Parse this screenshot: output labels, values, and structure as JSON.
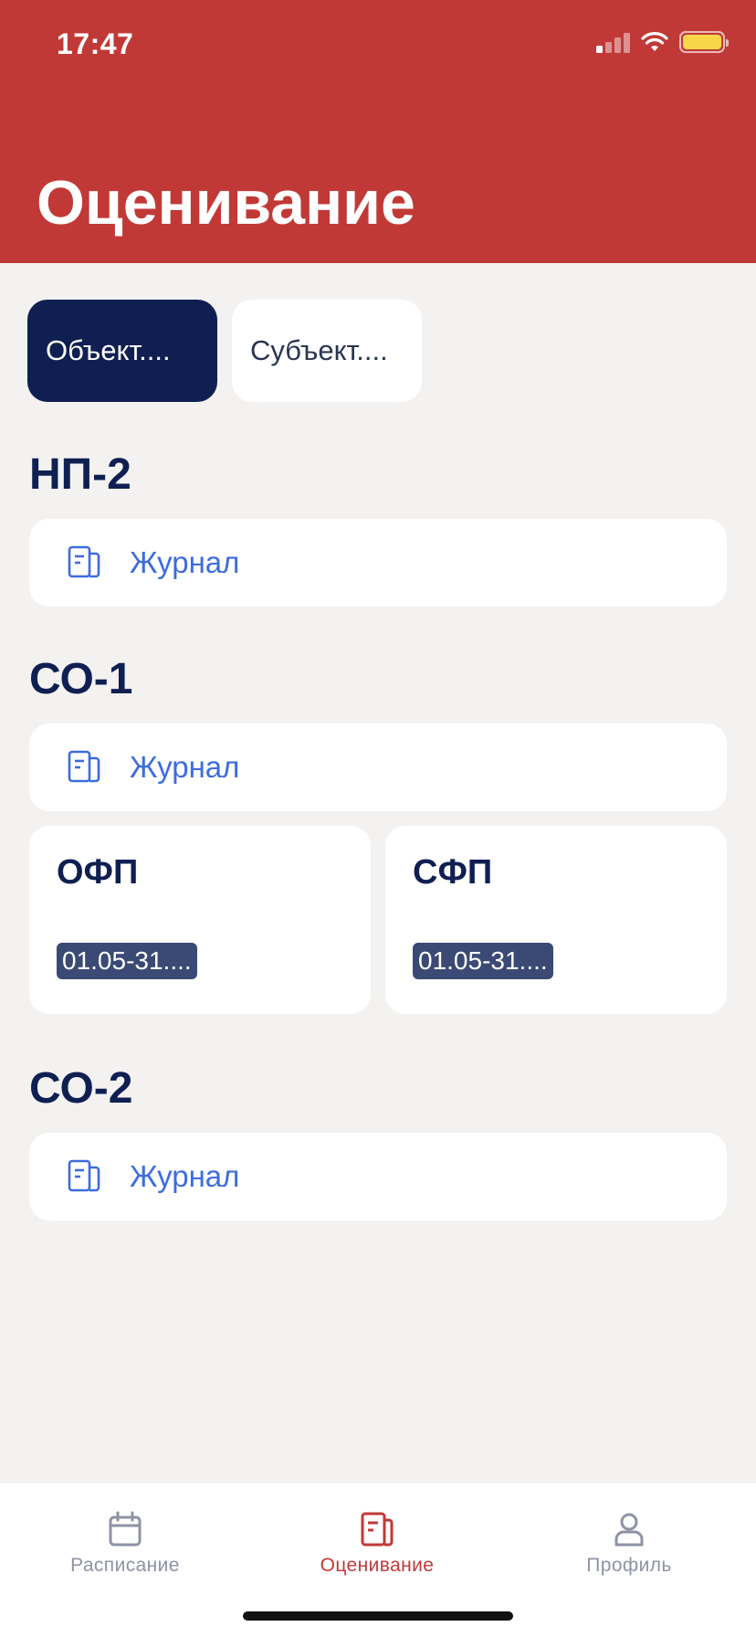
{
  "status_bar": {
    "time": "17:47"
  },
  "header": {
    "title": "Оценивание"
  },
  "segments": [
    {
      "label": "Объект....",
      "active": true
    },
    {
      "label": "Субъект....",
      "active": false
    }
  ],
  "groups": [
    {
      "title": "НП-2",
      "journal_label": "Журнал"
    },
    {
      "title": "СО-1",
      "journal_label": "Журнал",
      "tests": [
        {
          "title": "ОФП",
          "period": "01.05-31...."
        },
        {
          "title": "СФП",
          "period": "01.05-31...."
        }
      ]
    },
    {
      "title": "СО-2",
      "journal_label": "Журнал"
    }
  ],
  "tabbar": [
    {
      "label": "Расписание",
      "icon": "calendar-icon",
      "active": false
    },
    {
      "label": "Оценивание",
      "icon": "document-icon",
      "active": true
    },
    {
      "label": "Профиль",
      "icon": "person-icon",
      "active": false
    }
  ],
  "colors": {
    "brand_red": "#C13937",
    "navy": "#0F1F51",
    "link_blue": "#3D6CE0",
    "background": "#F3F2F1",
    "battery_yellow": "#F7D64A"
  }
}
